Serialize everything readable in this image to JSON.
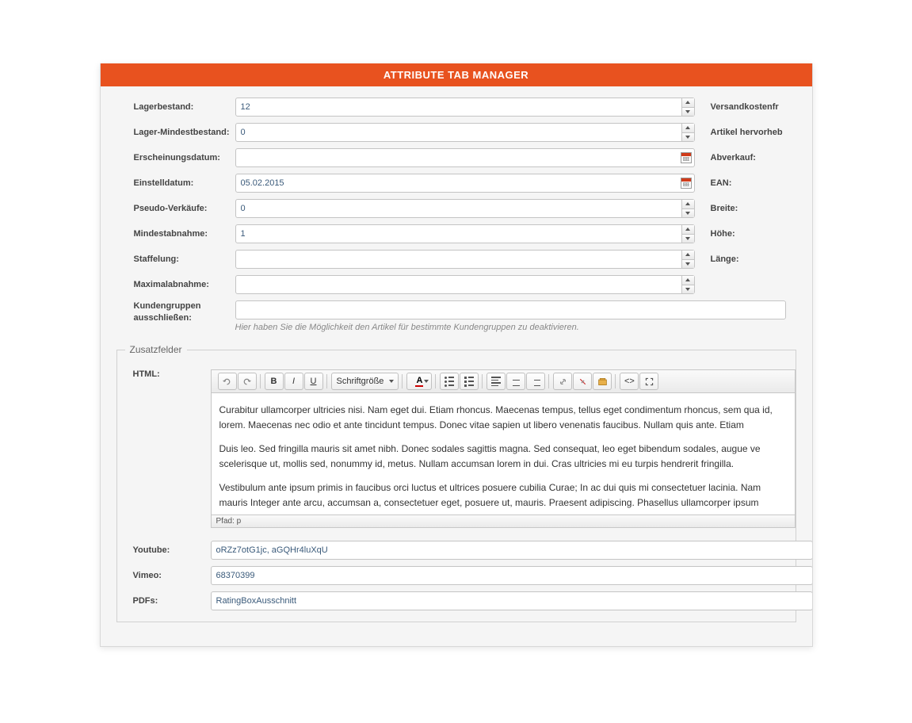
{
  "title": "ATTRIBUTE TAB MANAGER",
  "form": {
    "lagerbestand": {
      "label": "Lagerbestand:",
      "value": "12"
    },
    "lagermindest": {
      "label": "Lager-Mindestbestand:",
      "value": "0"
    },
    "erscheinungsdatum": {
      "label": "Erscheinungsdatum:",
      "value": ""
    },
    "einstelldatum": {
      "label": "Einstelldatum:",
      "value": "05.02.2015"
    },
    "pseudoverkaeufe": {
      "label": "Pseudo-Verkäufe:",
      "value": "0"
    },
    "mindestabnahme": {
      "label": "Mindestabnahme:",
      "value": "1"
    },
    "staffelung": {
      "label": "Staffelung:",
      "value": ""
    },
    "maximalabnahme": {
      "label": "Maximalabnahme:",
      "value": ""
    },
    "kundengruppen": {
      "label": "Kundengruppen ausschließen:",
      "value": ""
    },
    "kundengruppen_hint": "Hier haben Sie die Möglichkeit den Artikel für bestimmte Kundengruppen zu deaktivieren."
  },
  "rightLabels": {
    "versandkostenfrei": "Versandkostenfr",
    "artikelhervorheben": "Artikel hervorheb",
    "abverkauf": "Abverkauf:",
    "ean": "EAN:",
    "breite": "Breite:",
    "hoehe": "Höhe:",
    "laenge": "Länge:"
  },
  "fieldset": {
    "legend": "Zusatzfelder",
    "html_label": "HTML:",
    "toolbar": {
      "fontsize": "Schriftgröße"
    },
    "content_p1": "Curabitur ullamcorper ultricies nisi. Nam eget dui. Etiam rhoncus. Maecenas tempus, tellus eget condimentum rhoncus, sem qua id, lorem. Maecenas nec odio et ante tincidunt tempus. Donec vitae sapien ut libero venenatis faucibus. Nullam quis ante. Etiam",
    "content_p2": "Duis leo. Sed fringilla mauris sit amet nibh. Donec sodales sagittis magna. Sed consequat, leo eget bibendum sodales, augue ve scelerisque ut, mollis sed, nonummy id, metus. Nullam accumsan lorem in dui. Cras ultricies mi eu turpis hendrerit fringilla.",
    "content_p3": "Vestibulum ante ipsum primis in faucibus orci luctus et ultrices posuere cubilia Curae; In ac dui quis mi consectetuer lacinia. Nam mauris Integer ante arcu, accumsan a, consectetuer eget, posuere ut, mauris. Praesent adipiscing. Phasellus ullamcorper ipsum",
    "status": "Pfad: p",
    "youtube": {
      "label": "Youtube:",
      "value": "oRZz7otG1jc, aGQHr4luXqU"
    },
    "vimeo": {
      "label": "Vimeo:",
      "value": "68370399"
    },
    "pdfs": {
      "label": "PDFs:",
      "value": "RatingBoxAusschnitt"
    }
  }
}
